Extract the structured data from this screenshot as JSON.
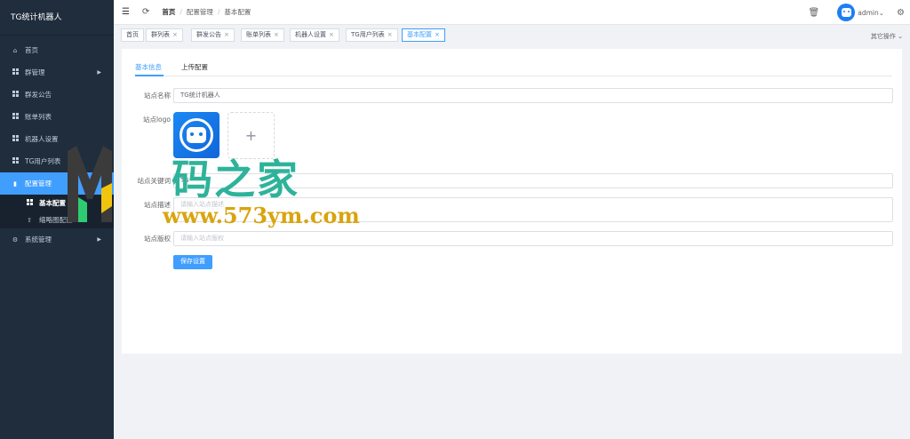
{
  "app": {
    "title": "TG统计机器人"
  },
  "sidebar": {
    "items": [
      {
        "label": "首页",
        "icon": "home-icon"
      },
      {
        "label": "群管理",
        "icon": "grid-icon",
        "has_children": true
      },
      {
        "label": "群发公告",
        "icon": "grid-icon"
      },
      {
        "label": "账单列表",
        "icon": "grid-icon"
      },
      {
        "label": "机器人设置",
        "icon": "grid-icon"
      },
      {
        "label": "TG用户列表",
        "icon": "grid-icon"
      },
      {
        "label": "配置管理",
        "icon": "bar-chart-icon",
        "active": true
      },
      {
        "label": "系统管理",
        "icon": "gear-icon",
        "has_children": true
      }
    ],
    "submenu": [
      {
        "label": "基本配置",
        "icon": "grid-icon",
        "current": true
      },
      {
        "label": "缩略图配置",
        "icon": "upload-icon"
      }
    ]
  },
  "header": {
    "breadcrumb": [
      "首页",
      "配置管理",
      "基本配置"
    ],
    "username": "admin"
  },
  "tags": {
    "items": [
      {
        "label": "首页",
        "closable": false
      },
      {
        "label": "群列表",
        "closable": true
      },
      {
        "label": "群发公告",
        "closable": true
      },
      {
        "label": "账单列表",
        "closable": true
      },
      {
        "label": "机器人设置",
        "closable": true
      },
      {
        "label": "TG用户列表",
        "closable": true
      },
      {
        "label": "基本配置",
        "closable": true,
        "active": true
      }
    ],
    "close_glyph": "×",
    "more_ops": "其它操作"
  },
  "tabs": [
    {
      "label": "基本信息",
      "active": true
    },
    {
      "label": "上传配置"
    }
  ],
  "form": {
    "site_name": {
      "label": "站点名称",
      "value": "TG统计机器人"
    },
    "site_logo": {
      "label": "站点logo",
      "upload_plus": "+"
    },
    "site_keywords": {
      "label": "站点关键词",
      "value": "TG"
    },
    "site_desc": {
      "label": "站点描述",
      "placeholder": "请输入站点描述"
    },
    "site_copyright": {
      "label": "站点版权",
      "placeholder": "请输入站点版权"
    },
    "save_label": "保存设置"
  },
  "watermark": {
    "text": "码之家",
    "url": "www.573ym.com"
  },
  "colors": {
    "sidebar_bg": "#1f2d3d",
    "accent": "#409eff",
    "watermark_green": "#2eb39a",
    "watermark_gold": "#d9a40e"
  }
}
